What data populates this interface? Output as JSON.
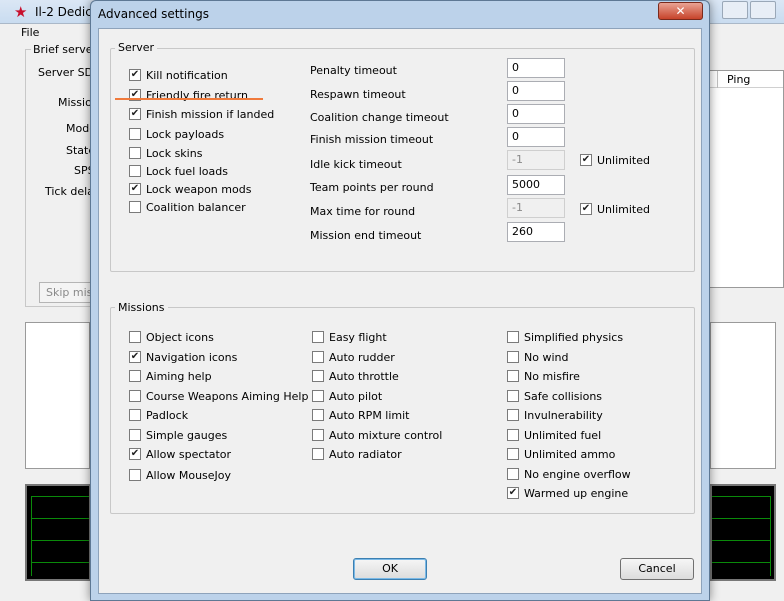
{
  "background_window": {
    "title": "Il-2 Dedic",
    "menu_file": "File",
    "group_title": "Brief server",
    "labels": [
      "Server SDS",
      "Mission",
      "Mode",
      "State",
      "SPS",
      "Tick delay"
    ],
    "skip_button": "Skip miss",
    "list_column": "Ping"
  },
  "dialog": {
    "title": "Advanced settings",
    "close_glyph": "✕",
    "server_group": {
      "title": "Server",
      "checkboxes": [
        {
          "label": "Kill notification",
          "checked": true
        },
        {
          "label": "Friendly fire return",
          "checked": true
        },
        {
          "label": "Finish mission if landed",
          "checked": true
        },
        {
          "label": "Lock payloads",
          "checked": false
        },
        {
          "label": "Lock skins",
          "checked": false
        },
        {
          "label": "Lock fuel loads",
          "checked": false
        },
        {
          "label": "Lock weapon mods",
          "checked": true
        },
        {
          "label": "Coalition balancer",
          "checked": false
        }
      ],
      "fields": [
        {
          "label": "Penalty timeout",
          "value": "0",
          "disabled": false
        },
        {
          "label": "Respawn timeout",
          "value": "0",
          "disabled": false
        },
        {
          "label": "Coalition change timeout",
          "value": "0",
          "disabled": false
        },
        {
          "label": "Finish mission timeout",
          "value": "0",
          "disabled": false
        },
        {
          "label": "Idle kick timeout",
          "value": "-1",
          "disabled": true,
          "unlimited_label": "Unlimited",
          "unlimited_checked": true
        },
        {
          "label": "Team points per round",
          "value": "5000",
          "disabled": false
        },
        {
          "label": "Max time for round",
          "value": "-1",
          "disabled": true,
          "unlimited_label": "Unlimited",
          "unlimited_checked": true
        },
        {
          "label": "Mission end timeout",
          "value": "260",
          "disabled": false
        }
      ]
    },
    "missions_group": {
      "title": "Missions",
      "col1": [
        {
          "label": "Object icons",
          "checked": false
        },
        {
          "label": "Navigation icons",
          "checked": true
        },
        {
          "label": "Aiming help",
          "checked": false
        },
        {
          "label": "Course Weapons Aiming Help",
          "checked": false
        },
        {
          "label": "Padlock",
          "checked": false
        },
        {
          "label": "Simple gauges",
          "checked": false
        },
        {
          "label": "Allow spectator",
          "checked": true
        },
        {
          "label": "Allow MouseJoy",
          "checked": false
        }
      ],
      "col2": [
        {
          "label": "Easy flight",
          "checked": false
        },
        {
          "label": "Auto rudder",
          "checked": false
        },
        {
          "label": "Auto throttle",
          "checked": false
        },
        {
          "label": "Auto pilot",
          "checked": false
        },
        {
          "label": "Auto RPM limit",
          "checked": false
        },
        {
          "label": "Auto mixture control",
          "checked": false
        },
        {
          "label": "Auto radiator",
          "checked": false
        }
      ],
      "col3": [
        {
          "label": "Simplified physics",
          "checked": false
        },
        {
          "label": "No wind",
          "checked": false
        },
        {
          "label": "No misfire",
          "checked": false
        },
        {
          "label": "Safe collisions",
          "checked": false
        },
        {
          "label": "Invulnerability",
          "checked": false
        },
        {
          "label": "Unlimited fuel",
          "checked": false
        },
        {
          "label": "Unlimited ammo",
          "checked": false
        },
        {
          "label": "No engine overflow",
          "checked": false
        },
        {
          "label": "Warmed up engine",
          "checked": true
        }
      ]
    },
    "ok_label": "OK",
    "cancel_label": "Cancel"
  },
  "colors": {
    "annotation_underline": "#f07a3c",
    "title_icon": "#c8102e",
    "graph_line": "#0a8a0a"
  }
}
